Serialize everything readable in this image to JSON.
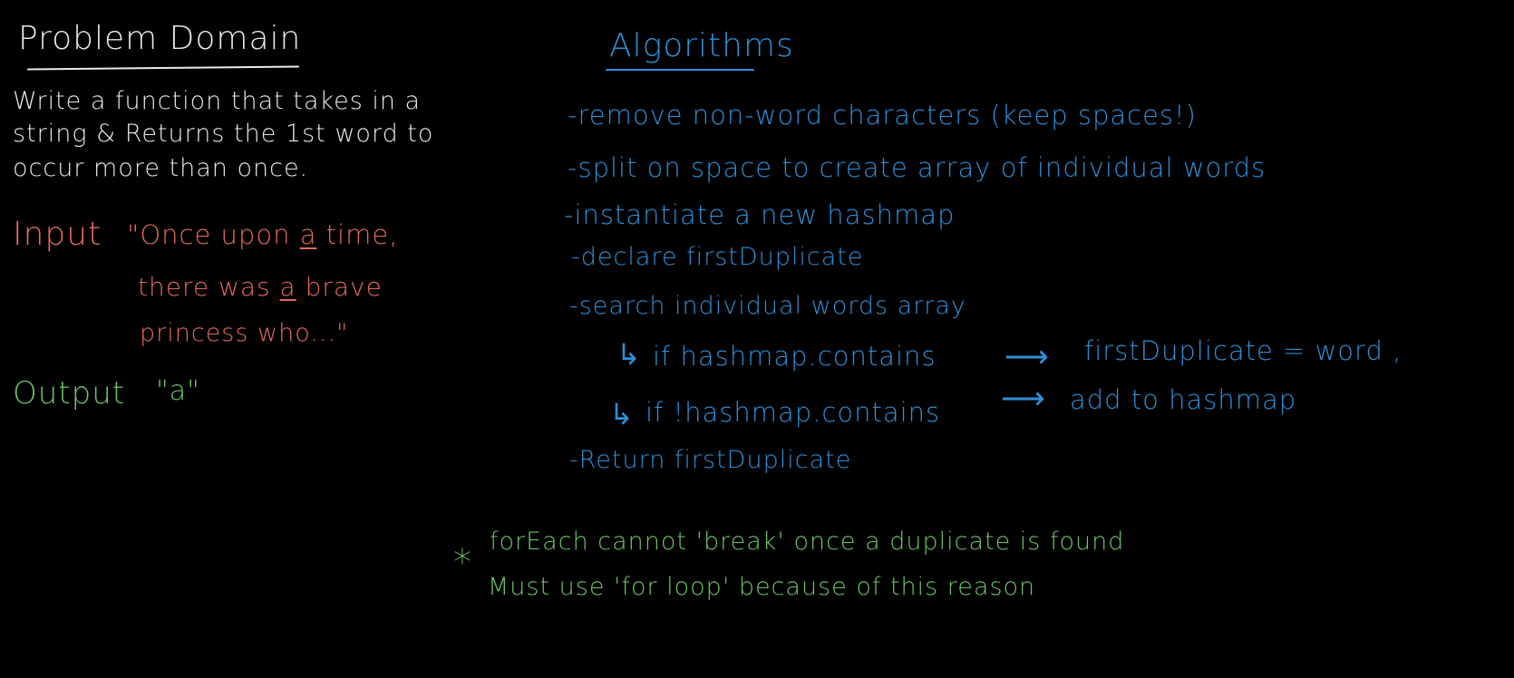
{
  "colors": {
    "background": "#000000",
    "white": "#eaeaea",
    "red": "#e36b5f",
    "green": "#6fc46a",
    "blue": "#2f8fd6"
  },
  "problem": {
    "title": "Problem Domain",
    "description": [
      "Write a function that takes in a",
      "string & Returns the 1st word to",
      "occur more than once."
    ],
    "input_label": "Input",
    "input_lines": {
      "line1_pre": "\"Once upon ",
      "line1_u": "a",
      "line1_post": " time,",
      "line2_pre": "there was ",
      "line2_u": "a",
      "line2_post": " brave",
      "line3": "princess who...\""
    },
    "output_label": "Output",
    "output_value": "\"a\""
  },
  "algorithm": {
    "title": "Algorithms",
    "steps": [
      "-remove non-word characters (keep spaces!)",
      "-split on space to create array of individual words",
      "-instantiate a new hashmap",
      "-declare firstDuplicate",
      "-search individual words array"
    ],
    "sub_steps": [
      {
        "arrow": "↳",
        "cond": "if  hashmap.contains",
        "result_arrow": "⟶",
        "result": "firstDuplicate = word ,"
      },
      {
        "arrow": "↳",
        "cond": "if  !hashmap.contains",
        "result_arrow": "⟶",
        "result": "add to hashmap"
      }
    ],
    "final_step": "-Return firstDuplicate"
  },
  "note": {
    "star": "*",
    "line1": "forEach cannot 'break' once a duplicate is found",
    "line2": "Must use 'for loop' because of this reason"
  }
}
